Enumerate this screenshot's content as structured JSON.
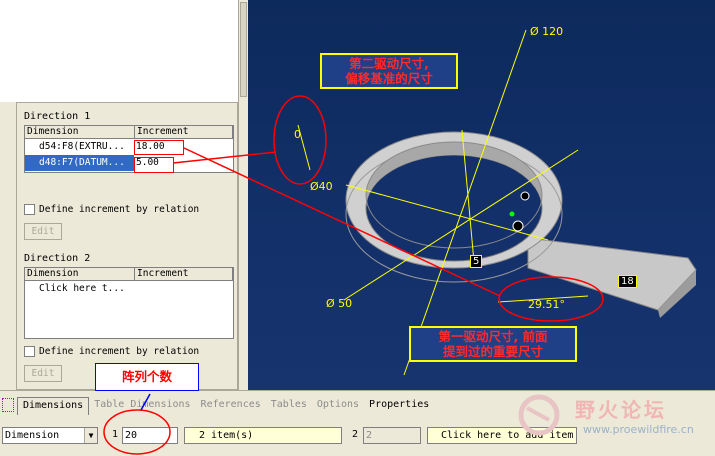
{
  "dialog": {
    "direction1_label": "Direction 1",
    "direction2_label": "Direction 2",
    "col_dimension": "Dimension",
    "col_increment": "Increment",
    "dir1_rows": [
      {
        "dimension": "d54:F8(EXTRU...",
        "increment": "18.00"
      },
      {
        "dimension": "d48:F7(DATUM...",
        "increment": "5.00"
      }
    ],
    "dir2_row": "Click here t...",
    "define_by_relation": "Define increment by relation",
    "edit_label": "Edit"
  },
  "tabs": [
    "Dimensions",
    "Table Dimensions",
    "References",
    "Tables",
    "Options",
    "Properties"
  ],
  "bottom": {
    "type_select": "Dimension",
    "num1_label": "1",
    "count1_value": "20",
    "items_text": "2 item(s)",
    "num2_label": "2",
    "count2_value": "2",
    "click_add_item": "Click here to add item"
  },
  "annotations": {
    "second_driving": [
      "第二驱动尺寸,",
      "偏移基准的尺寸"
    ],
    "first_driving": [
      "第一驱动尺寸, 前面",
      "提到过的重要尺寸"
    ],
    "pattern_count": "阵列个数"
  },
  "model_dims": {
    "d120": "Ø 120",
    "d40": "Ø40",
    "d50": "Ø 50",
    "a29": "29.51°",
    "len18": "18",
    "small5": "5",
    "small0": "0"
  },
  "watermark": {
    "text": "野火论坛",
    "url": "www.proewildfire.cn"
  },
  "colors": {
    "viewport_bg": "#13306a",
    "annotation_red": "#ff0000",
    "dimension_yellow": "#ffff00",
    "selection_blue": "#316ac5"
  }
}
